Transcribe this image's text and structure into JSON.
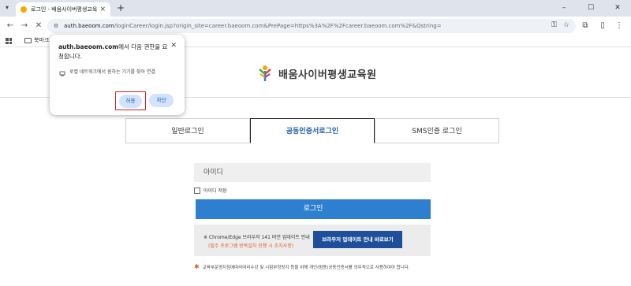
{
  "browser": {
    "tab_title": "로그인 - 배움사이버평생교육원",
    "url_host": "auth.baeoom.com",
    "url_rest": "/loginCareer/login.jsp?origin_site=career.baeoom.com&PrePage=https%3A%2F%2Fcareer.baeoom.com%2F&Qstring=",
    "bookmark_folder": "북마크"
  },
  "popup": {
    "title_host": "auth.baeoom.com",
    "title_rest": "에서 다음 권한을 요청합니다.",
    "description": "로컬 네트워크에서 원하는 기기를 찾아 연결",
    "allow_label": "허용",
    "block_label": "차단"
  },
  "header": {
    "logo_text": "배움사이버평생교육원"
  },
  "login": {
    "tabs": [
      {
        "label": "일반로그인"
      },
      {
        "label": "공동인증서로그인"
      },
      {
        "label": "SMS인증 로그인"
      }
    ],
    "id_placeholder": "아이디",
    "save_id_label": "아이디 저장",
    "login_button": "로그인",
    "notice_line1": "※ Chrome/Edge 브라우저 141 버전 업데이트 안내",
    "notice_line2": "(필수 프로그램 반복설치 진행 시 조치사항)",
    "update_button": "브라우저 업데이트 안내 바로보기",
    "footnote": "교육부운영지침에따라대리수강 및 시험부정방지 등을 위해 개인(범용)공동인증서를 의무적으로 사용하여야 합니다."
  },
  "colors": {
    "accent": "#2f7fd1",
    "active_tab_text": "#1f5fa8",
    "notice_red": "#e05a2a",
    "update_button": "#1f4e9a"
  }
}
